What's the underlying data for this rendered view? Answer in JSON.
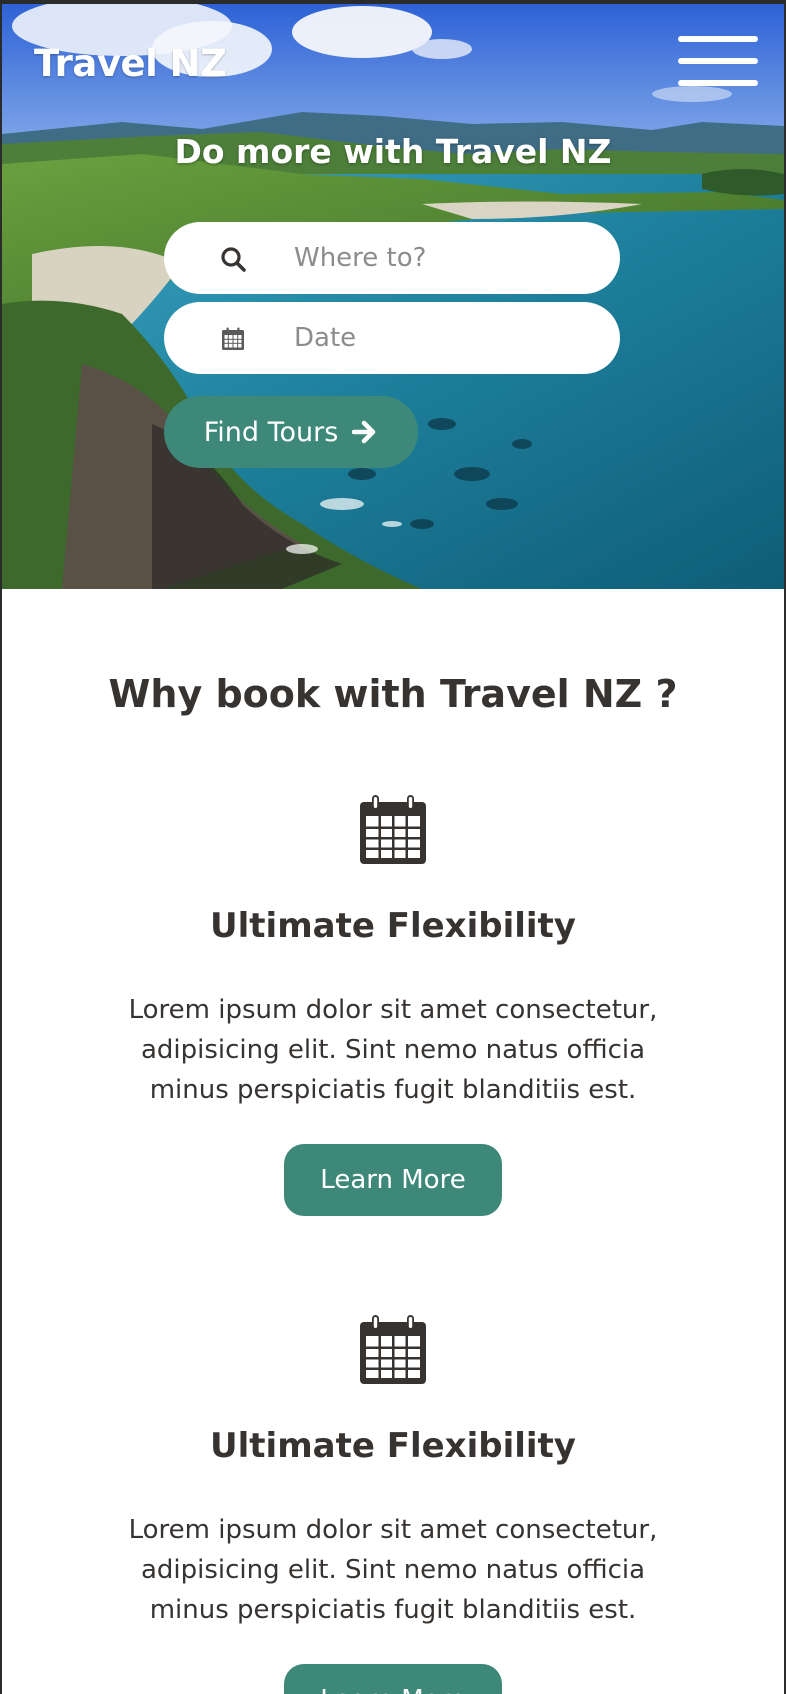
{
  "header": {
    "brand": "Travel NZ",
    "menu_icon": "hamburger-menu-icon"
  },
  "hero": {
    "title": "Do more with Travel NZ",
    "search": {
      "placeholder": "Where to?",
      "icon": "search-icon"
    },
    "date": {
      "placeholder": "Date",
      "icon": "calendar-icon"
    },
    "find_button": {
      "label": "Find Tours",
      "icon": "arrow-right-icon"
    }
  },
  "why": {
    "heading": "Why book with Travel NZ ?",
    "features": [
      {
        "icon": "calendar-icon",
        "title": "Ultimate Flexibility",
        "description": "Lorem ipsum dolor sit amet consectetur, adipisicing elit. Sint nemo natus officia minus perspiciatis fugit blanditiis est.",
        "button": "Learn More"
      },
      {
        "icon": "calendar-icon",
        "title": "Ultimate Flexibility",
        "description": "Lorem ipsum dolor sit amet consectetur, adipisicing elit. Sint nemo natus officia minus perspiciatis fugit blanditiis est.",
        "button": "Learn More"
      }
    ]
  },
  "colors": {
    "accent": "#3d8878",
    "text": "#373331",
    "placeholder": "#8c8c8c",
    "frame": "#2b2b2b"
  }
}
